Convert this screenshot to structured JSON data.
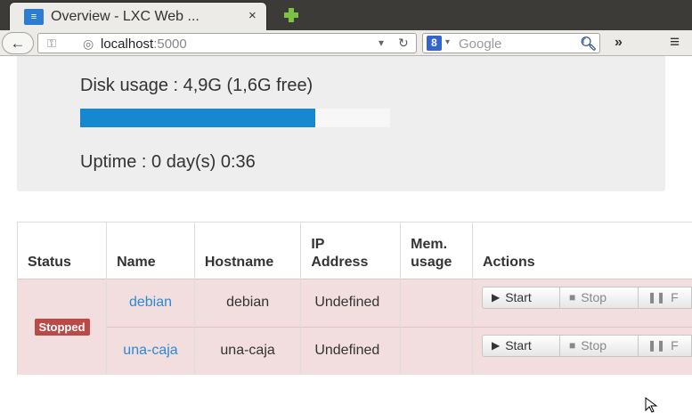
{
  "browser": {
    "tab_title": "Overview - LXC Web ...",
    "tab_icon_text": "≡",
    "tab_close": "×",
    "url_host": "localhost",
    "url_port": ":5000",
    "search_placeholder": "Google",
    "overflow": "»",
    "menu": "≡",
    "back": "🡐"
  },
  "stats": {
    "disk_label": "Disk usage : 4,9G (1,6G free)",
    "disk_used_fraction": 0.76,
    "uptime_label": "Uptime : 0 day(s) 0:36"
  },
  "table": {
    "headers": {
      "status": "Status",
      "name": "Name",
      "hostname": "Hostname",
      "ip_line1": "IP",
      "ip_line2": "Address",
      "mem_line1": "Mem.",
      "mem_line2": "usage",
      "actions": "Actions"
    },
    "status_badge": "Stopped",
    "rows": [
      {
        "name": "debian",
        "hostname": "debian",
        "ip": "Undefined",
        "mem": ""
      },
      {
        "name": "una-caja",
        "hostname": "una-caja",
        "ip": "Undefined",
        "mem": ""
      }
    ],
    "actions": {
      "start": "Start",
      "stop": "Stop",
      "freeze": "F"
    }
  },
  "colors": {
    "progress_fill": "#1588d0",
    "row_stopped_bg": "#f2dede",
    "badge_bg": "#b94a48",
    "link": "#2a8ad4"
  }
}
